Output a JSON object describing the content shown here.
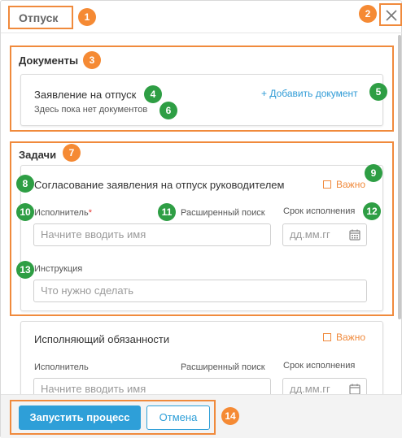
{
  "dialog": {
    "title": "Отпуск",
    "close_icon": "close-icon"
  },
  "documents": {
    "section_title": "Документы",
    "doc_title": "Заявление на отпуск",
    "empty_text": "Здесь пока нет документов",
    "add_link": "+ Добавить документ"
  },
  "tasks": {
    "section_title": "Задачи",
    "task1": {
      "title": "Согласование заявления на отпуск руководителем",
      "important_label": "Важно",
      "executor_label": "Исполнитель",
      "required_mark": "*",
      "advanced_search": "Расширенный поиск",
      "executor_placeholder": "Начните вводить имя",
      "deadline_label": "Срок исполнения",
      "deadline_placeholder": "дд.мм.гг",
      "instruction_label": "Инструкция",
      "instruction_placeholder": "Что нужно сделать"
    },
    "task2": {
      "title": "Исполняющий обязанности",
      "important_label": "Важно",
      "executor_label": "Исполнитель",
      "advanced_search": "Расширенный поиск",
      "executor_placeholder": "Начните вводить имя",
      "deadline_label": "Срок исполнения",
      "deadline_placeholder": "дд.мм.гг"
    }
  },
  "footer": {
    "start_button": "Запустить процесс",
    "cancel_button": "Отмена"
  },
  "badges": [
    "1",
    "2",
    "3",
    "4",
    "5",
    "6",
    "7",
    "8",
    "9",
    "10",
    "11",
    "12",
    "13",
    "14"
  ],
  "colors": {
    "accent": "#2e9fd8",
    "annotation_orange": "#f58a34",
    "annotation_green": "#2e9e44",
    "important": "#f08a3c"
  }
}
